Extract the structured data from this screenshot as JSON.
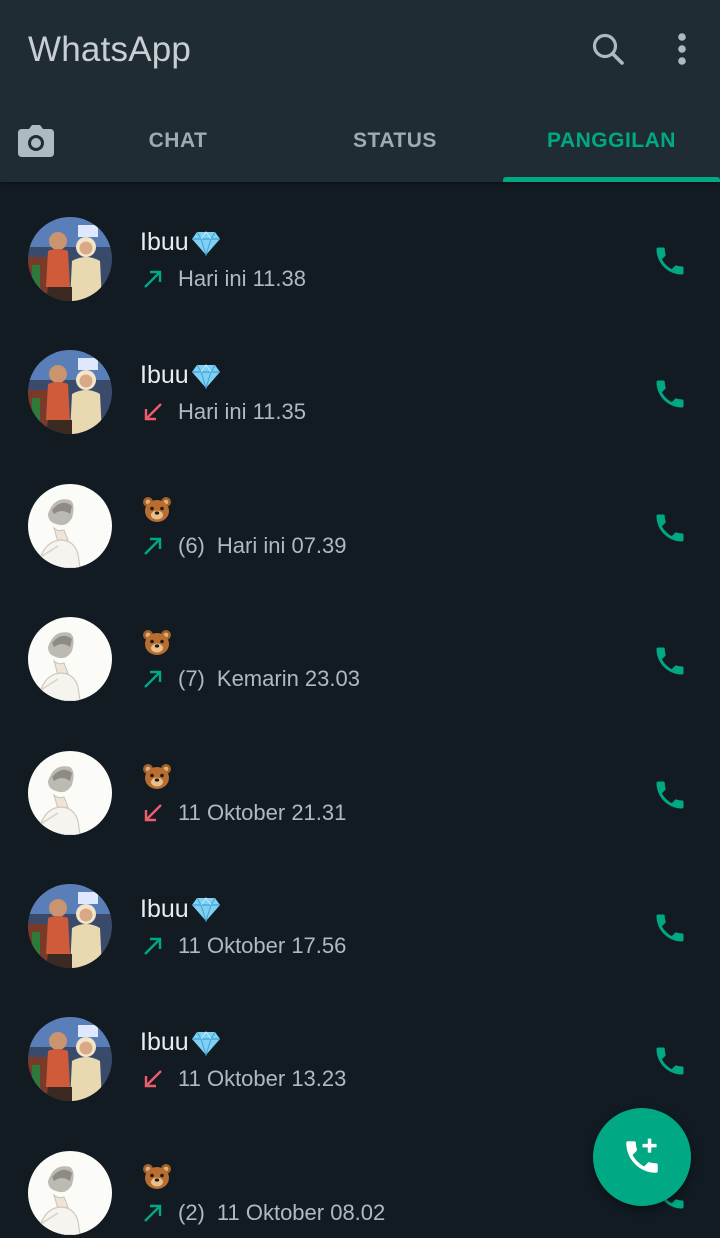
{
  "app": {
    "title": "WhatsApp",
    "accent": "#00a884",
    "missed_color": "#f15c6d"
  },
  "header": {
    "icons": [
      "search-icon",
      "more-options-icon"
    ]
  },
  "tabs": [
    {
      "icon": "camera-icon"
    },
    {
      "label": "CHAT"
    },
    {
      "label": "STATUS"
    },
    {
      "label": "PANGGILAN",
      "active": true
    }
  ],
  "calls": [
    {
      "name": "Ibuu",
      "emoji": "gem-emoji",
      "direction": "outgoing",
      "count": "",
      "time": "Hari ini 11.38",
      "avatar": "photo"
    },
    {
      "name": "Ibuu",
      "emoji": "gem-emoji",
      "direction": "missed",
      "count": "",
      "time": "Hari ini 11.35",
      "avatar": "photo"
    },
    {
      "name": "",
      "emoji": "bear-emoji",
      "direction": "outgoing",
      "count": "(6)",
      "time": "Hari ini 07.39",
      "avatar": "sketch"
    },
    {
      "name": "",
      "emoji": "bear-emoji",
      "direction": "outgoing",
      "count": "(7)",
      "time": "Kemarin 23.03",
      "avatar": "sketch"
    },
    {
      "name": "",
      "emoji": "bear-emoji",
      "direction": "missed",
      "count": "",
      "time": "11 Oktober 21.31",
      "avatar": "sketch"
    },
    {
      "name": "Ibuu",
      "emoji": "gem-emoji",
      "direction": "outgoing",
      "count": "",
      "time": "11 Oktober 17.56",
      "avatar": "photo"
    },
    {
      "name": "Ibuu",
      "emoji": "gem-emoji",
      "direction": "missed",
      "count": "",
      "time": "11 Oktober 13.23",
      "avatar": "photo"
    },
    {
      "name": "",
      "emoji": "bear-emoji",
      "direction": "outgoing",
      "count": "(2)",
      "time": "11 Oktober 08.02",
      "avatar": "sketch"
    }
  ],
  "fab": {
    "icon": "new-call-icon"
  }
}
